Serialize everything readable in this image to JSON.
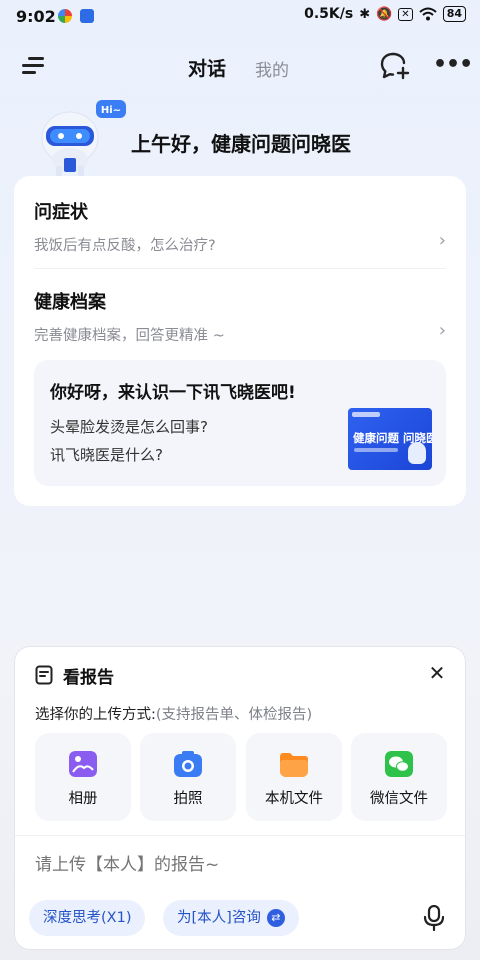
{
  "status_bar": {
    "time": "9:02",
    "network_speed": "0.5K/s",
    "battery": "84",
    "icons": [
      "bluetooth-icon",
      "mute-icon",
      "sim-x-icon",
      "wifi-icon",
      "battery-icon"
    ]
  },
  "nav": {
    "tabs": [
      {
        "label": "对话",
        "active": true
      },
      {
        "label": "我的",
        "active": false
      }
    ],
    "icons": [
      "menu-icon",
      "new-chat-icon",
      "more-icon"
    ]
  },
  "greeting": "上午好，健康问题问晓医",
  "mascot_badge": "Hi~",
  "entries": [
    {
      "title": "问症状",
      "subtitle": "我饭后有点反酸，怎么治疗?"
    },
    {
      "title": "健康档案",
      "subtitle": "完善健康档案，回答更精准 ~"
    }
  ],
  "intro_card": {
    "title": "你好呀，来认识一下讯飞晓医吧!",
    "questions": [
      "头晕脸发烫是怎么回事?",
      "讯飞晓医是什么?"
    ],
    "thumbnail_text": "健康问题 问晓医"
  },
  "report_panel": {
    "title": "看报告",
    "hint_main": "选择你的上传方式:",
    "hint_sub": "(支持报告单、体检报告)",
    "options": [
      {
        "label": "相册",
        "icon": "album-icon",
        "color": "#8b5cf0"
      },
      {
        "label": "拍照",
        "icon": "camera-icon",
        "color": "#3b7cf5"
      },
      {
        "label": "本机文件",
        "icon": "folder-icon",
        "color": "#ff8a1f"
      },
      {
        "label": "微信文件",
        "icon": "wechat-icon",
        "color": "#2fc24a"
      }
    ],
    "input_placeholder": "请上传【本人】的报告~",
    "chips": [
      {
        "label": "深度思考(X1)"
      },
      {
        "label": "为[本人]咨询"
      }
    ]
  },
  "colors": {
    "accent": "#2553c8",
    "chip_bg": "#eaf0fd"
  }
}
